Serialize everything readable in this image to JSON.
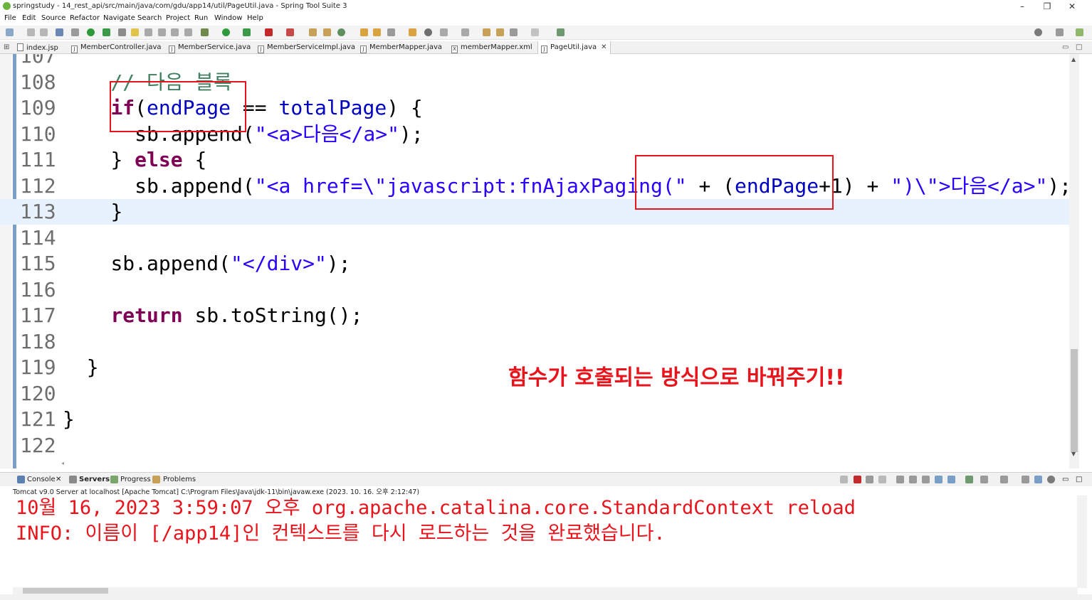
{
  "window": {
    "title": "springstudy - 14_rest_api/src/main/java/com/gdu/app14/util/PageUtil.java - Spring Tool Suite 3",
    "minimize": "–",
    "restore": "❐",
    "close": "✕"
  },
  "menu": [
    "File",
    "Edit",
    "Source",
    "Refactor",
    "Navigate",
    "Search",
    "Project",
    "Run",
    "Window",
    "Help"
  ],
  "tabs": [
    {
      "label": "index.jsp",
      "icon": "file-icon"
    },
    {
      "label": "MemberController.java",
      "icon": "java-file-icon"
    },
    {
      "label": "MemberService.java",
      "icon": "java-file-icon"
    },
    {
      "label": "MemberServiceImpl.java",
      "icon": "java-file-icon"
    },
    {
      "label": "MemberMapper.java",
      "icon": "java-file-icon"
    },
    {
      "label": "memberMapper.xml",
      "icon": "xml-file-icon"
    },
    {
      "label": "PageUtil.java",
      "icon": "java-file-icon",
      "active": true
    }
  ],
  "code_lines": [
    {
      "num": "107",
      "indent": "",
      "tokens": []
    },
    {
      "num": "108",
      "indent": "    ",
      "tokens": [
        {
          "t": "// 다음 블록",
          "c": "cmt"
        }
      ]
    },
    {
      "num": "109",
      "indent": "    ",
      "tokens": [
        {
          "t": "if",
          "c": "kw"
        },
        {
          "t": "(",
          "c": ""
        },
        {
          "t": "endPage",
          "c": "fld"
        },
        {
          "t": " == ",
          "c": ""
        },
        {
          "t": "totalPage",
          "c": "fld"
        },
        {
          "t": ") {",
          "c": ""
        }
      ]
    },
    {
      "num": "110",
      "indent": "      ",
      "tokens": [
        {
          "t": "sb.append(",
          "c": ""
        },
        {
          "t": "\"<a>다음</a>\"",
          "c": "str"
        },
        {
          "t": ");",
          "c": ""
        }
      ]
    },
    {
      "num": "111",
      "indent": "    ",
      "tokens": [
        {
          "t": "} ",
          "c": ""
        },
        {
          "t": "else",
          "c": "kw"
        },
        {
          "t": " {",
          "c": ""
        }
      ]
    },
    {
      "num": "112",
      "indent": "      ",
      "tokens": [
        {
          "t": "sb.append(",
          "c": ""
        },
        {
          "t": "\"<a href=\\\"javascript:fnAjaxPaging(\"",
          "c": "str"
        },
        {
          "t": " + (",
          "c": ""
        },
        {
          "t": "endPage",
          "c": "fld"
        },
        {
          "t": "+1) + ",
          "c": ""
        },
        {
          "t": "\")\\\">다음</a>\"",
          "c": "str"
        },
        {
          "t": ");",
          "c": ""
        }
      ]
    },
    {
      "num": "113",
      "indent": "    ",
      "tokens": [
        {
          "t": "}",
          "c": ""
        }
      ],
      "current": true
    },
    {
      "num": "114",
      "indent": "",
      "tokens": []
    },
    {
      "num": "115",
      "indent": "    ",
      "tokens": [
        {
          "t": "sb.append(",
          "c": ""
        },
        {
          "t": "\"</div>\"",
          "c": "str"
        },
        {
          "t": ");",
          "c": ""
        }
      ]
    },
    {
      "num": "116",
      "indent": "",
      "tokens": []
    },
    {
      "num": "117",
      "indent": "    ",
      "tokens": [
        {
          "t": "return",
          "c": "kw"
        },
        {
          "t": " sb.toString();",
          "c": ""
        }
      ]
    },
    {
      "num": "118",
      "indent": "",
      "tokens": []
    },
    {
      "num": "119",
      "indent": "  ",
      "tokens": [
        {
          "t": "}",
          "c": ""
        }
      ]
    },
    {
      "num": "120",
      "indent": "",
      "tokens": []
    },
    {
      "num": "121",
      "indent": "",
      "tokens": [
        {
          "t": "}",
          "c": ""
        }
      ]
    },
    {
      "num": "122",
      "indent": "",
      "tokens": []
    }
  ],
  "annotation": "함수가 호출되는 방식으로 바꿔주기!!",
  "console": {
    "tabs": [
      {
        "label": "Console",
        "icon": "console-icon"
      },
      {
        "label": "Servers",
        "icon": "servers-icon"
      },
      {
        "label": "Progress",
        "icon": "progress-icon"
      },
      {
        "label": "Problems",
        "icon": "problems-icon"
      }
    ],
    "info": "Tomcat v9.0 Server at localhost [Apache Tomcat] C:\\Program Files\\Java\\jdk-11\\bin\\javaw.exe  (2023. 10. 16. 오후 2:12:47)",
    "lines": [
      "10월 16, 2023 3:59:07 오후 org.apache.catalina.core.StandardContext reload",
      "INFO: 이름이 [/app14]인 컨텍스트를 다시 로드하는 것을 완료했습니다."
    ]
  },
  "colors": {
    "annotation_red": "#e8131b",
    "keyword": "#7f0055",
    "string": "#2a00ff",
    "comment": "#3f7f5f",
    "field": "#0000c0",
    "current_line": "#e8f2fe"
  }
}
